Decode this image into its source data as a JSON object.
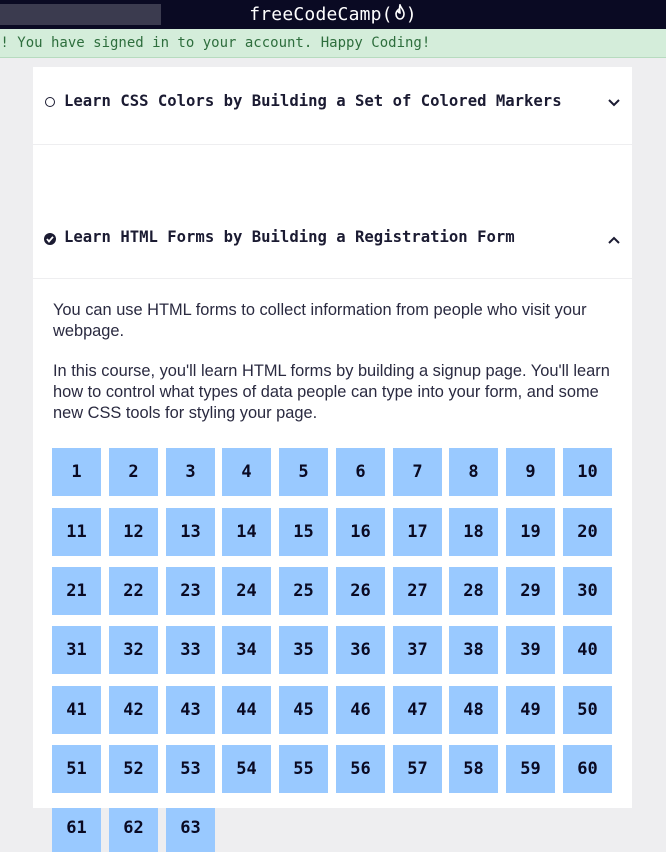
{
  "navbar": {
    "logo_text": "freeCodeCamp(",
    "logo_flame": "🔥",
    "logo_close": ")"
  },
  "flash": {
    "message": "s! You have signed in to your account. Happy Coding!"
  },
  "blocks": [
    {
      "title": "Learn CSS Colors by Building a Set of Colored Markers",
      "completed": false,
      "expanded": false,
      "chevron": "chevron-down-icon"
    },
    {
      "title": "Learn HTML Forms by Building a Registration Form",
      "completed": true,
      "expanded": true,
      "chevron": "chevron-up-icon",
      "description": [
        "You can use HTML forms to collect information from people who visit your webpage.",
        "In this course, you'll learn HTML forms by building a signup page. You'll learn how to control what types of data people can type into your form, and some new CSS tools for styling your page."
      ],
      "steps": [
        "1",
        "2",
        "3",
        "4",
        "5",
        "6",
        "7",
        "8",
        "9",
        "10",
        "11",
        "12",
        "13",
        "14",
        "15",
        "16",
        "17",
        "18",
        "19",
        "20",
        "21",
        "22",
        "23",
        "24",
        "25",
        "26",
        "27",
        "28",
        "29",
        "30",
        "31",
        "32",
        "33",
        "34",
        "35",
        "36",
        "37",
        "38",
        "39",
        "40",
        "41",
        "42",
        "43",
        "44",
        "45",
        "46",
        "47",
        "48",
        "49",
        "50",
        "51",
        "52",
        "53",
        "54",
        "55",
        "56",
        "57",
        "58",
        "59",
        "60",
        "61",
        "62",
        "63"
      ]
    }
  ],
  "colors": {
    "nav_bg": "#0a0a23",
    "flash_bg": "#d4edda",
    "flash_text": "#2e6e3d",
    "step_bg": "#99c9ff",
    "text_dark": "#1b1b32"
  }
}
